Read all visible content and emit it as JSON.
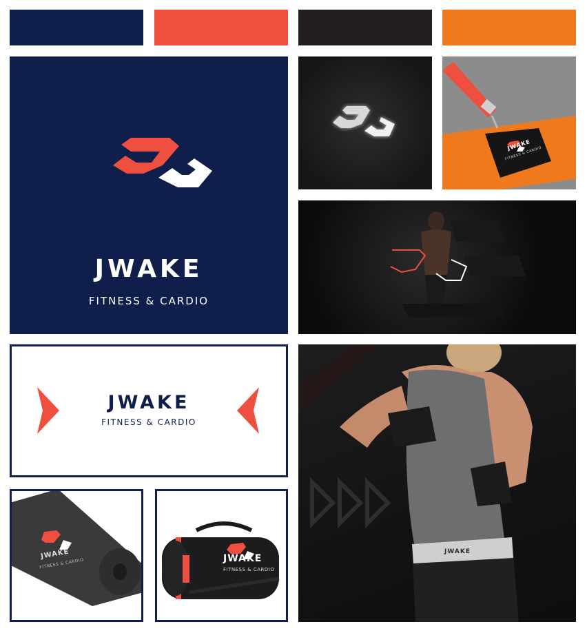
{
  "brand": {
    "name": "JWAKE",
    "tagline": "FITNESS & CARDIO"
  },
  "palette": [
    {
      "name": "navy",
      "hex": "#0f1e4b"
    },
    {
      "name": "coral-red",
      "hex": "#ef4f3e"
    },
    {
      "name": "charcoal",
      "hex": "#231f20"
    },
    {
      "name": "orange",
      "hex": "#ef7a1e"
    }
  ],
  "mockups": {
    "sign_icon": "jj-monogram-icon",
    "badge": {
      "name": "JWAKE",
      "tagline": "FITNESS & CARDIO"
    },
    "mat": {
      "name": "JWAKE",
      "tagline": "FITNESS & CARDIO"
    },
    "bag": {
      "name": "JWAKE",
      "tagline": "FITNESS & CARDIO"
    },
    "waistband": "JWAKE"
  }
}
